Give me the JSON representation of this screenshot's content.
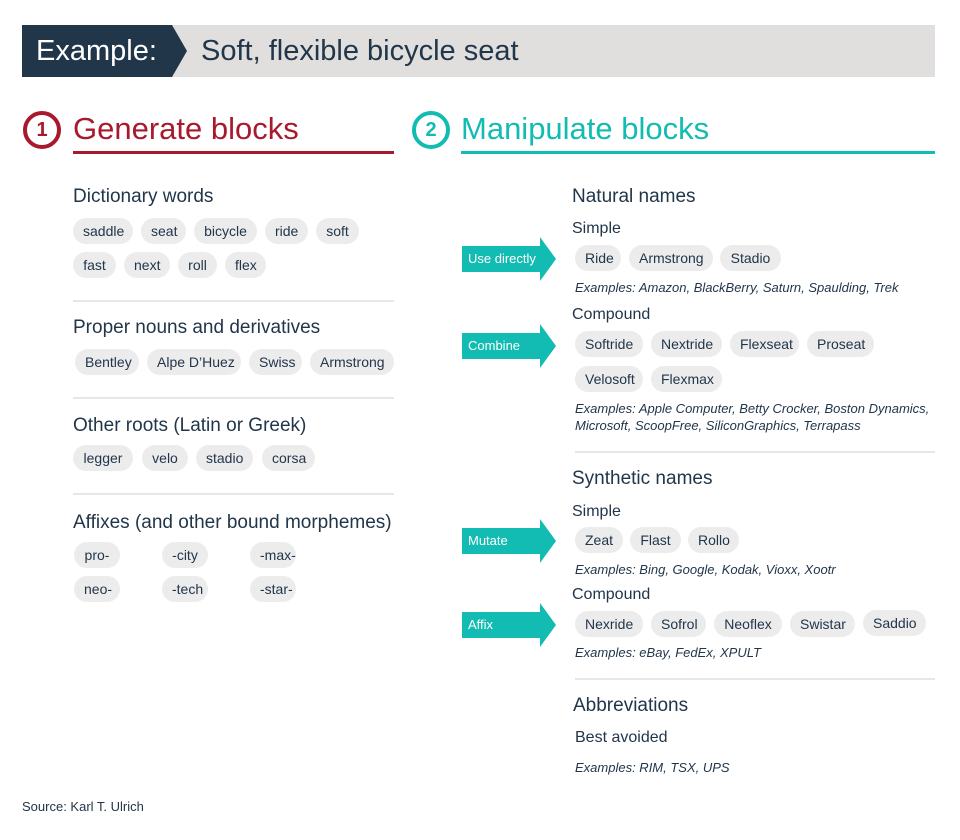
{
  "banner": {
    "label": "Example:",
    "title": "Soft, flexible bicycle seat"
  },
  "colors": {
    "navy": "#22364a",
    "red": "#a8192e",
    "teal": "#13bcb2",
    "chip": "#ececec",
    "banner_bg": "#e0dfde"
  },
  "generate": {
    "number": "1",
    "title": "Generate blocks",
    "groups": [
      {
        "title": "Dictionary words",
        "chips": [
          "saddle",
          "seat",
          "bicycle",
          "ride",
          "soft",
          "fast",
          "next",
          "roll",
          "flex"
        ]
      },
      {
        "title": "Proper nouns and derivatives",
        "chips": [
          "Bentley",
          "Alpe D’Huez",
          "Swiss",
          "Armstrong"
        ]
      },
      {
        "title": "Other roots (Latin or Greek)",
        "chips": [
          "legger",
          "velo",
          "stadio",
          "corsa"
        ]
      },
      {
        "title": "Affixes (and other bound morphemes)",
        "chips": [
          "pro-",
          "-city",
          "-max-",
          "neo-",
          "-tech",
          "-star-"
        ]
      }
    ]
  },
  "manipulate": {
    "number": "2",
    "title": "Manipulate blocks",
    "natural": {
      "title": "Natural names",
      "simple": {
        "title": "Simple",
        "action": "Use directly",
        "chips": [
          "Ride",
          "Armstrong",
          "Stadio"
        ],
        "examples": "Examples: Amazon, BlackBerry, Saturn, Spaulding, Trek"
      },
      "compound": {
        "title": "Compound",
        "action": "Combine",
        "chips": [
          "Softride",
          "Nextride",
          "Flexseat",
          "Proseat",
          "Velosoft",
          "Flexmax"
        ],
        "examples_line1": "Examples: Apple Computer, Betty Crocker, Boston Dynamics,",
        "examples_line2": "Microsoft, ScoopFree, SiliconGraphics, Terrapass"
      }
    },
    "synthetic": {
      "title": "Synthetic names",
      "simple": {
        "title": "Simple",
        "action": "Mutate",
        "chips": [
          "Zeat",
          "Flast",
          "Rollo"
        ],
        "examples": "Examples: Bing, Google, Kodak, Vioxx, Xootr"
      },
      "compound": {
        "title": "Compound",
        "action": "Affix",
        "chips": [
          "Nexride",
          "Sofrol",
          "Neoflex",
          "Swistar",
          "Saddio"
        ],
        "examples": "Examples: eBay, FedEx, XPULT"
      }
    },
    "abbreviations": {
      "title": "Abbreviations",
      "subtitle": "Best avoided",
      "examples": "Examples: RIM, TSX, UPS"
    }
  },
  "source": "Source: Karl T. Ulrich"
}
